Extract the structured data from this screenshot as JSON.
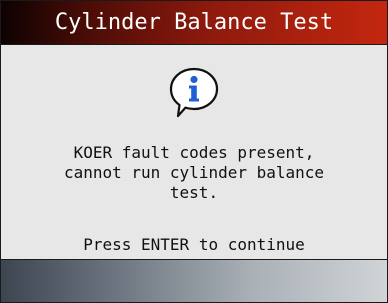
{
  "title": "Cylinder Balance Test",
  "icon": "info-icon",
  "message_lines": [
    "KOER fault codes present,",
    "cannot run cylinder balance",
    "test."
  ],
  "prompt": "Press ENTER to continue",
  "colors": {
    "title_start": "#0d0202",
    "title_end": "#c4270f",
    "footer_start": "#3d4650",
    "footer_end": "#d0d4d7",
    "background": "#e7e7e7",
    "icon_blue": "#1f5fd8"
  }
}
